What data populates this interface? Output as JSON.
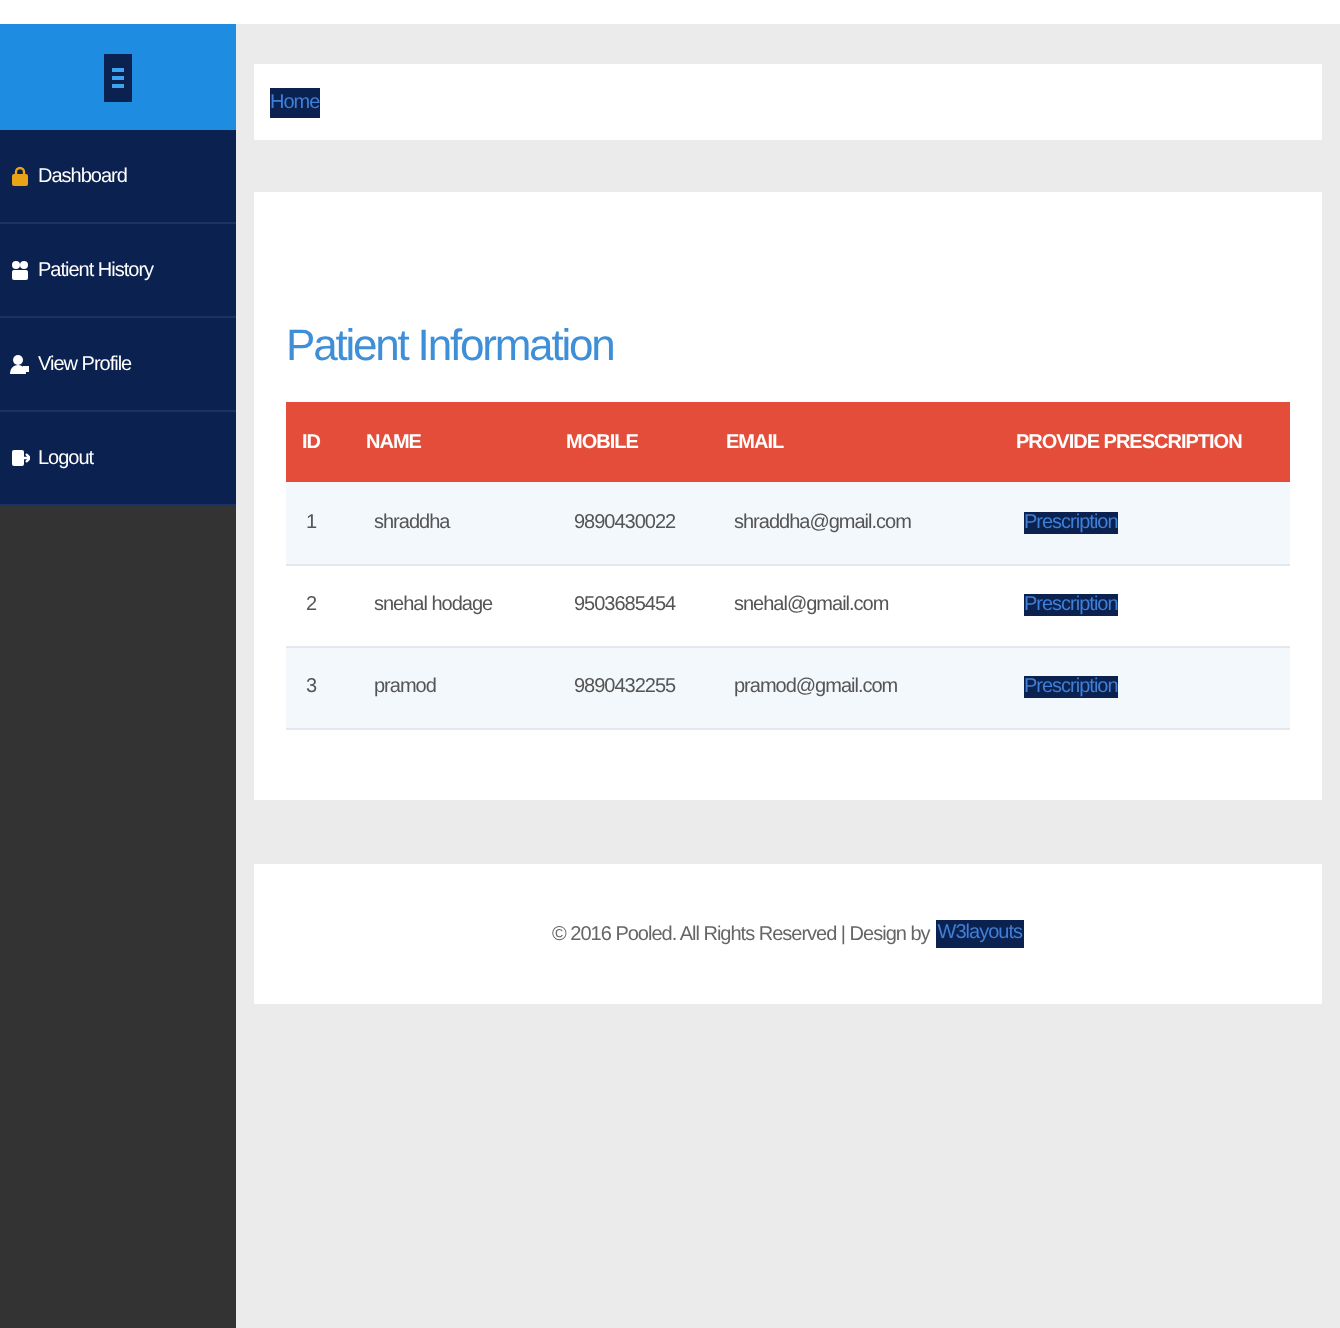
{
  "sidebar": {
    "items": [
      {
        "label": "Dashboard",
        "kind": "dashboard"
      },
      {
        "label": "Patient History",
        "kind": "history"
      },
      {
        "label": "View Profile",
        "kind": "profile"
      },
      {
        "label": "Logout",
        "kind": "logout"
      }
    ]
  },
  "breadcrumb": {
    "link": "Home"
  },
  "panel": {
    "title": "Patient Information",
    "table": {
      "columns": [
        "ID",
        "NAME",
        "MOBILE",
        "EMAIL",
        "PROVIDE PRESCRIPTION"
      ],
      "rows": [
        {
          "id": "1",
          "name": "shraddha",
          "mobile": "9890430022",
          "email": "shraddha@gmail.com",
          "action": "Prescription"
        },
        {
          "id": "2",
          "name": "snehal hodage",
          "mobile": "9503685454",
          "email": "snehal@gmail.com",
          "action": "Prescription"
        },
        {
          "id": "3",
          "name": "pramod",
          "mobile": "9890432255",
          "email": "pramod@gmail.com",
          "action": "Prescription"
        }
      ]
    }
  },
  "footer": {
    "text": "© 2016 Pooled. All Rights Reserved | Design by",
    "link": "W3layouts"
  }
}
